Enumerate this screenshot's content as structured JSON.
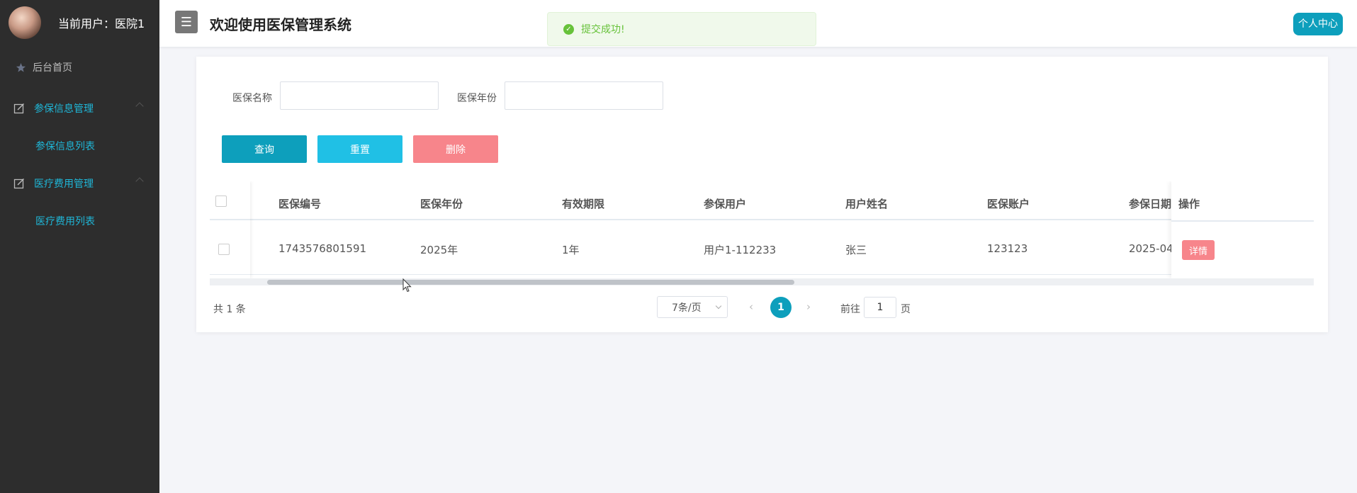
{
  "sidebar": {
    "user_label": "当前用户：",
    "user_name": "医院1",
    "menu": [
      {
        "label": "后台首页",
        "icon": "home-icon"
      },
      {
        "label": "参保信息管理",
        "icon": "edit-icon",
        "sub": "参保信息列表"
      },
      {
        "label": "医疗费用管理",
        "icon": "edit-icon",
        "sub": "医疗费用列表"
      }
    ]
  },
  "header": {
    "menu_icon": "☰",
    "title": "欢迎使用医保管理系统",
    "profile": "个人中心"
  },
  "toast": {
    "message": "提交成功!",
    "icon": "check-circle-icon"
  },
  "filters": {
    "name_label": "医保名称",
    "name_value": "",
    "year_label": "医保年份",
    "year_value": ""
  },
  "buttons": {
    "search": "查询",
    "reset": "重置",
    "delete": "删除"
  },
  "table": {
    "columns": [
      "医保编号",
      "医保年份",
      "有效期限",
      "参保用户",
      "用户姓名",
      "医保账户",
      "参保日期",
      "操作"
    ],
    "rows": [
      {
        "id": "1743576801591",
        "year": "2025年",
        "period": "1年",
        "insured_user": "用户1-112233",
        "user_name": "张三",
        "account": "123123",
        "date": "2025-04",
        "action": "详情"
      }
    ]
  },
  "pagination": {
    "total": "共 1 条",
    "page_size": "7条/页",
    "current_page": "1",
    "goto_prefix": "前往",
    "goto_value": "1",
    "goto_suffix": "页"
  },
  "colors": {
    "sidebar_bg": "#2d2d2d",
    "accent": "#0d9fbc",
    "reset": "#20c0e5",
    "danger": "#f7858b",
    "success": "#67c23a"
  }
}
